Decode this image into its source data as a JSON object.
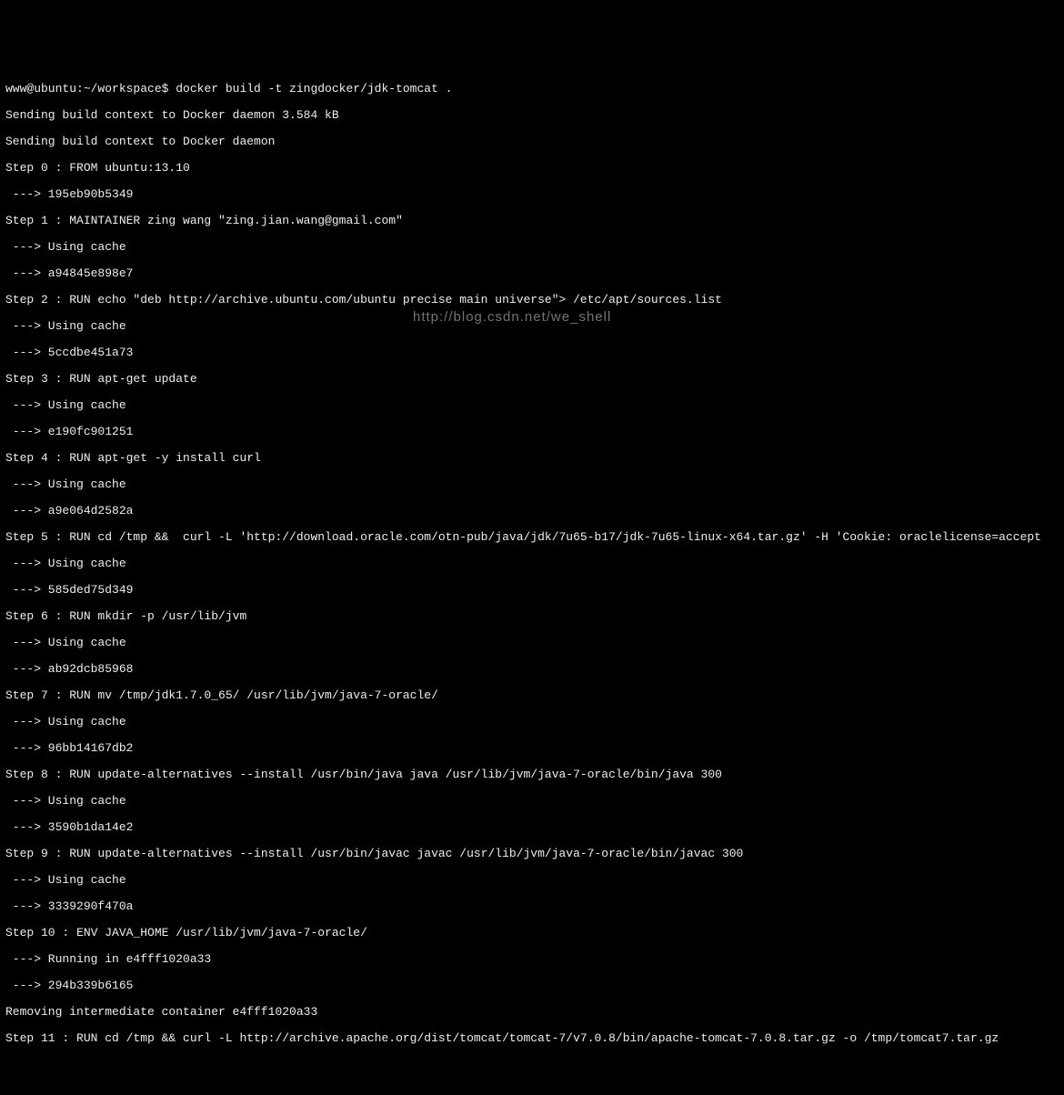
{
  "watermark": "http://blog.csdn.net/we_shell",
  "prompt": "www@ubuntu:~/workspace$ ",
  "command": "docker build -t zingdocker/jdk-tomcat .",
  "lines": [
    "Sending build context to Docker daemon 3.584 kB",
    "Sending build context to Docker daemon",
    "Step 0 : FROM ubuntu:13.10",
    " ---> 195eb90b5349",
    "Step 1 : MAINTAINER zing wang \"zing.jian.wang@gmail.com\"",
    " ---> Using cache",
    " ---> a94845e898e7",
    "Step 2 : RUN echo \"deb http://archive.ubuntu.com/ubuntu precise main universe\"> /etc/apt/sources.list",
    " ---> Using cache",
    " ---> 5ccdbe451a73",
    "Step 3 : RUN apt-get update",
    " ---> Using cache",
    " ---> e190fc901251",
    "Step 4 : RUN apt-get -y install curl",
    " ---> Using cache",
    " ---> a9e064d2582a",
    "Step 5 : RUN cd /tmp &&  curl -L 'http://download.oracle.com/otn-pub/java/jdk/7u65-b17/jdk-7u65-linux-x64.tar.gz' -H 'Cookie: oraclelicense=accept",
    " ---> Using cache",
    " ---> 585ded75d349",
    "Step 6 : RUN mkdir -p /usr/lib/jvm",
    " ---> Using cache",
    " ---> ab92dcb85968",
    "Step 7 : RUN mv /tmp/jdk1.7.0_65/ /usr/lib/jvm/java-7-oracle/",
    " ---> Using cache",
    " ---> 96bb14167db2",
    "Step 8 : RUN update-alternatives --install /usr/bin/java java /usr/lib/jvm/java-7-oracle/bin/java 300",
    " ---> Using cache",
    " ---> 3590b1da14e2",
    "Step 9 : RUN update-alternatives --install /usr/bin/javac javac /usr/lib/jvm/java-7-oracle/bin/javac 300",
    " ---> Using cache",
    " ---> 3339290f470a",
    "Step 10 : ENV JAVA_HOME /usr/lib/jvm/java-7-oracle/",
    " ---> Running in e4fff1020a33",
    " ---> 294b339b6165",
    "Removing intermediate container e4fff1020a33",
    "Step 11 : RUN cd /tmp && curl -L http://archive.apache.org/dist/tomcat/tomcat-7/v7.0.8/bin/apache-tomcat-7.0.8.tar.gz -o /tmp/tomcat7.tar.gz"
  ]
}
